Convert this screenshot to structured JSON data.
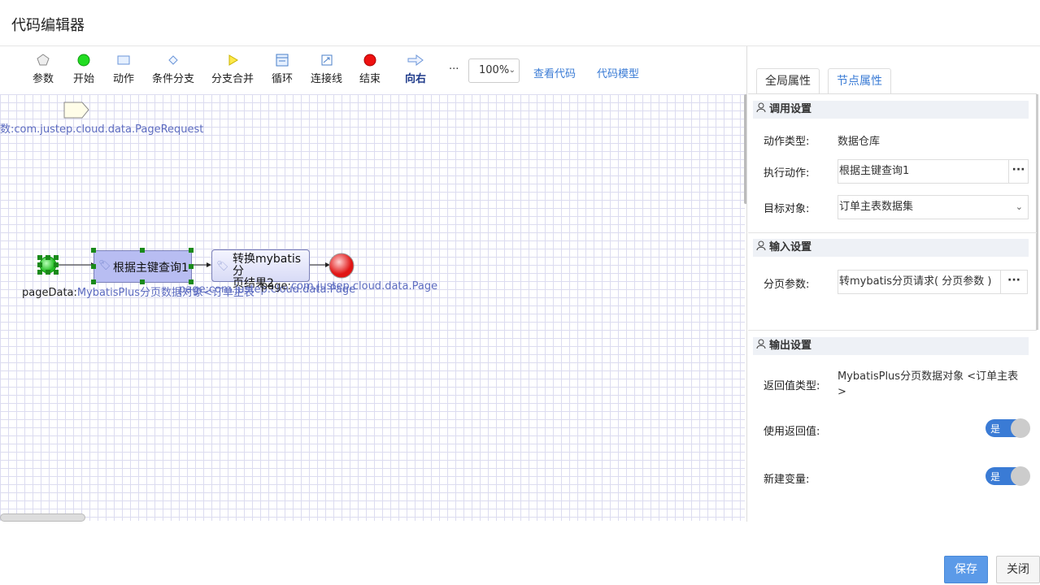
{
  "app": {
    "title": "代码编辑器"
  },
  "toolbar": {
    "items": [
      {
        "label": "参数",
        "icon": "pentagon-icon"
      },
      {
        "label": "开始",
        "icon": "green-circle-icon"
      },
      {
        "label": "动作",
        "icon": "rectangle-icon"
      },
      {
        "label": "条件分支",
        "icon": "diamond-icon"
      },
      {
        "label": "分支合并",
        "icon": "triangle-icon"
      },
      {
        "label": "循环",
        "icon": "loop-icon"
      },
      {
        "label": "连接线",
        "icon": "connector-icon"
      },
      {
        "label": "结束",
        "icon": "red-circle-icon"
      },
      {
        "label": "向右",
        "icon": "right-arrow-icon"
      }
    ],
    "more": "···",
    "zoom": "100%",
    "view_code": "查看代码",
    "code_model": "代码模型"
  },
  "canvas": {
    "param_label": "数:com.justep.cloud.data.PageRequest",
    "node1_label": "根据主键查询1",
    "node2_label_line1": "转换mybatis分",
    "node2_label_line2": "页结果2",
    "start_label_prefix": "pageData:",
    "start_label_blue": "MybatisPlus分页数据对象<订单主表",
    "node1_out": "page:com.justep.cloud.data.Page",
    "node2_out_prefix": "page:",
    "node2_out_blue": "com.justep.cloud.data.Page"
  },
  "panel": {
    "tabs": [
      {
        "label": "全局属性",
        "active": false
      },
      {
        "label": "节点属性",
        "active": true
      }
    ],
    "call_section": "调用设置",
    "action_type_label": "动作类型:",
    "action_type_value": "数据仓库",
    "exec_action_label": "执行动作:",
    "exec_action_value": "根据主键查询1",
    "target_label": "目标对象:",
    "target_value": "订单主表数据集",
    "input_section": "输入设置",
    "page_param_label": "分页参数:",
    "page_param_value": "转mybatis分页请求(  分页参数  )",
    "output_section": "输出设置",
    "return_type_label": "返回值类型:",
    "return_type_value": "MybatisPlus分页数据对象 <订单主表 >",
    "use_return_label": "使用返回值:",
    "use_return_state": "是",
    "new_var_label": "新建变量:",
    "new_var_state": "是",
    "dots": "···"
  },
  "footer": {
    "save": "保存",
    "close": "关闭"
  }
}
